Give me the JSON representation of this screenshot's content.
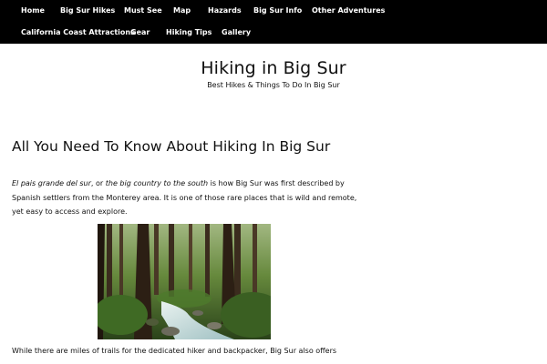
{
  "nav": {
    "row1": [
      "Home",
      "Big Sur Hikes",
      "Must See",
      "Map",
      "Hazards",
      "Big Sur Info",
      "Other Adventures"
    ],
    "row2": [
      "California Coast Attractions",
      "Gear",
      "Hiking Tips",
      "Gallery"
    ]
  },
  "header": {
    "title": "Hiking in Big Sur",
    "tagline": "Best Hikes & Things To Do In Big Sur"
  },
  "article": {
    "title": "All You Need To Know About Hiking In Big Sur",
    "intro_em1": "El pais grande del sur",
    "intro_mid": ", or ",
    "intro_em2": "the big country to the south",
    "intro_rest": " is how Big Sur was first described by Spanish settlers from the Monterey area. It is one of those rare places that is wild and remote, yet easy to access and explore.",
    "para2": "While there are miles of trails for the dedicated hiker and backpacker, Big Sur also offers"
  },
  "colors": {
    "nav_bg": "#000000",
    "nav_text": "#ffffff",
    "text": "#111111",
    "background": "#ffffff"
  }
}
